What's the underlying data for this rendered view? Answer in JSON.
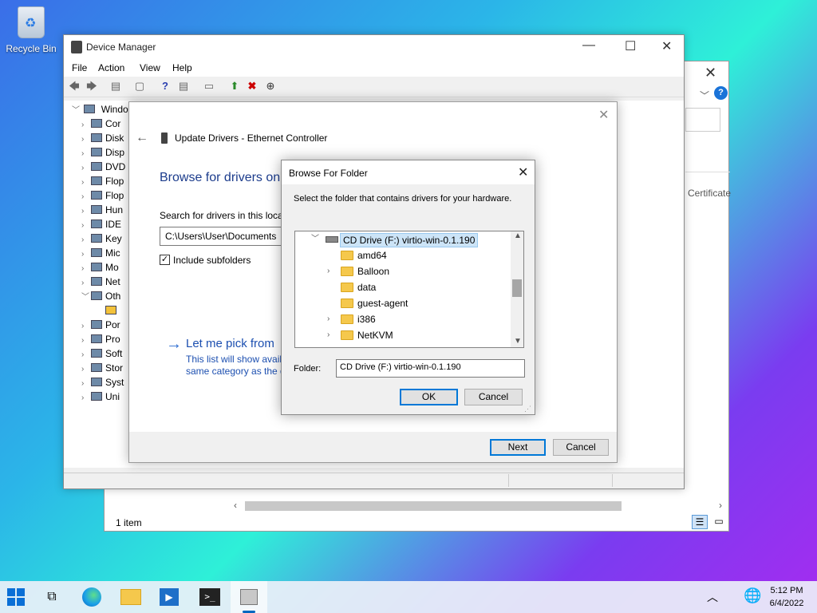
{
  "desktop": {
    "recycle_bin_label": "Recycle Bin"
  },
  "explorer": {
    "status_text": "1 item",
    "certificate_label": "Certificate"
  },
  "device_manager": {
    "title": "Device Manager",
    "menu": [
      "File",
      "Action",
      "View",
      "Help"
    ],
    "tree_root": "Windo",
    "tree_items": [
      "Cor",
      "Disk",
      "Disp",
      "DVD",
      "Flop",
      "Flop",
      "Hun",
      "IDE",
      "Key",
      "Mic",
      "Mo",
      "Net",
      "Oth",
      "",
      "Por",
      "Pro",
      "Soft",
      "Stor",
      "Syst",
      "Uni"
    ]
  },
  "wizard": {
    "title": "Update Drivers - Ethernet Controller",
    "heading": "Browse for drivers on",
    "search_label": "Search for drivers in this locat",
    "path_value": "C:\\Users\\User\\Documents",
    "include_subfolders_label": "Include subfolders",
    "include_subfolders_checked": true,
    "pick_title": "Let me pick from",
    "pick_desc_1": "This list will show avail",
    "pick_desc_2": "same category as the d",
    "next_label": "Next",
    "cancel_label": "Cancel"
  },
  "browse": {
    "title": "Browse For Folder",
    "description": "Select the folder that contains drivers for your hardware.",
    "root": "CD Drive (F:) virtio-win-0.1.190",
    "folders": [
      "amd64",
      "Balloon",
      "data",
      "guest-agent",
      "i386",
      "NetKVM"
    ],
    "folder_label": "Folder:",
    "folder_value": "CD Drive (F:) virtio-win-0.1.190",
    "ok_label": "OK",
    "cancel_label": "Cancel"
  },
  "taskbar": {
    "time": "5:12 PM",
    "date": "6/4/2022"
  },
  "colors": {
    "accent": "#0078d7",
    "link": "#1c4fb0"
  }
}
